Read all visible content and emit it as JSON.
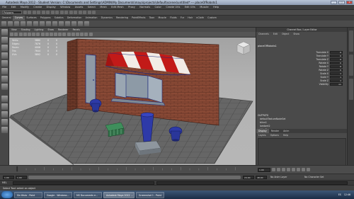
{
  "window": {
    "title": "Autodesk Maya 2012 - Student Version: C:\\Documents and Settings\\ADMIN\\My Documents\\maya\\projects\\default\\scenes\\untitled*   ---   placeOfRobots1",
    "controls": [
      "_",
      "□",
      "X"
    ]
  },
  "menubar": {
    "items": [
      "File",
      "Edit",
      "Modify",
      "Create",
      "Display",
      "Window",
      "Assets",
      "Select",
      "Mesh",
      "Edit Mesh",
      "Proxy",
      "Normals",
      "Color",
      "Create UVs",
      "Edit UVs",
      "Muscle",
      "Help"
    ]
  },
  "statusline": {
    "mode": "Polygons"
  },
  "shelf": {
    "tabs": [
      "General",
      "Curves",
      "Surfaces",
      "Polygons",
      "Subdivs",
      "Deformation",
      "Animation",
      "Dynamics",
      "Rendering",
      "PaintEffects",
      "Toon",
      "Muscle",
      "Fluids",
      "Fur",
      "Hair",
      "nCloth",
      "Custom"
    ],
    "active_index": 1
  },
  "viewport": {
    "menu": [
      "View",
      "Shading",
      "Lighting",
      "Show",
      "Renderer",
      "Panels"
    ],
    "hud": [
      {
        "label": "Verts:",
        "v1": "3880",
        "v2": "0",
        "v3": "0"
      },
      {
        "label": "Edges:",
        "v1": "7876",
        "v2": "0",
        "v3": "0"
      },
      {
        "label": "Faces:",
        "v1": "4006",
        "v2": "0",
        "v3": "0"
      },
      {
        "label": "Tris:",
        "v1": "7644",
        "v2": "0",
        "v3": "0"
      },
      {
        "label": "UVs:",
        "v1": "3892",
        "v2": "0",
        "v3": "0"
      }
    ],
    "colors": {
      "brick": "#8a4a36",
      "awning_red": "#c21a18",
      "awning_white": "#f2ece6",
      "floor": "#6b6b6b",
      "wireframe": "#1f2a7a"
    }
  },
  "channel_box": {
    "title": "Channel Box / Layer Editor",
    "tabs": [
      "Channels",
      "Edit",
      "Object",
      "Show"
    ],
    "object_name": "placeOfRobots1",
    "attributes": [
      {
        "label": "Translate X",
        "value": "0"
      },
      {
        "label": "Translate Y",
        "value": "0"
      },
      {
        "label": "Translate Z",
        "value": "0"
      },
      {
        "label": "Rotate X",
        "value": "0"
      },
      {
        "label": "Rotate Y",
        "value": "0"
      },
      {
        "label": "Rotate Z",
        "value": "0"
      },
      {
        "label": "Scale X",
        "value": "1"
      },
      {
        "label": "Scale Y",
        "value": "1"
      },
      {
        "label": "Scale Z",
        "value": "1"
      },
      {
        "label": "Visibility",
        "value": "on"
      }
    ],
    "sections": {
      "header": "OUTPUTS",
      "items": [
        "defaultTextureNodeSet",
        "blinn1",
        "lambert2",
        "blinn2"
      ]
    },
    "bottom_tabs": [
      "Display",
      "Render",
      "Anim"
    ],
    "bottom_active_index": 0,
    "layer_menu": [
      "Layers",
      "Options",
      "Help"
    ]
  },
  "time": {
    "start": "1.00",
    "end": "24.00",
    "range_start": "1.00",
    "range_end": "48.00",
    "current": "1.00",
    "anim_layer": "No Anim Layer",
    "char_set": "No Character Set"
  },
  "cmdline": {
    "label": "MEL"
  },
  "helpline": {
    "text": "Select Tool: select an object"
  },
  "taskbar": {
    "buttons": [
      "Sin título - Paint",
      "Google - Windows...",
      "MS Documents e...",
      "Autodesk Maya 2012 ...",
      "Screenshot 1 - Paint"
    ],
    "clock": "12:46",
    "lang": "ES"
  }
}
